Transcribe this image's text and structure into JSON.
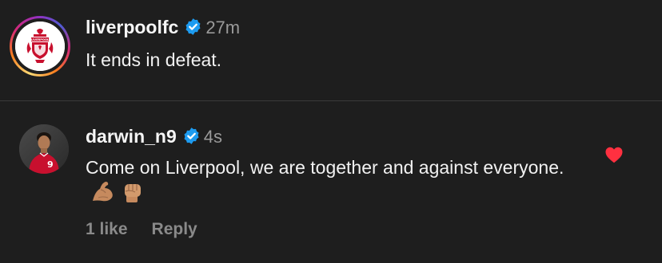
{
  "post": {
    "username": "liverpoolfc",
    "time": "27m",
    "text": "It ends in defeat.",
    "crest_text": "LIVERPOOL"
  },
  "comment": {
    "username": "darwin_n9",
    "time": "4s",
    "text": "Come on Liverpool, we are together and against everyone.",
    "emojis": [
      "flexed-biceps-emoji",
      "raised-fist-emoji"
    ],
    "likes_label": "1 like",
    "reply_label": "Reply",
    "jersey_number": "9",
    "liked": true
  },
  "icons": {
    "verified": "verified-badge-icon",
    "heart": "heart-icon"
  },
  "colors": {
    "background": "#1e1e1e",
    "verified_blue": "#1d9bf0",
    "heart_red": "#ff3040",
    "muted_text": "#8a8a8a",
    "lfc_red": "#c8102e"
  }
}
